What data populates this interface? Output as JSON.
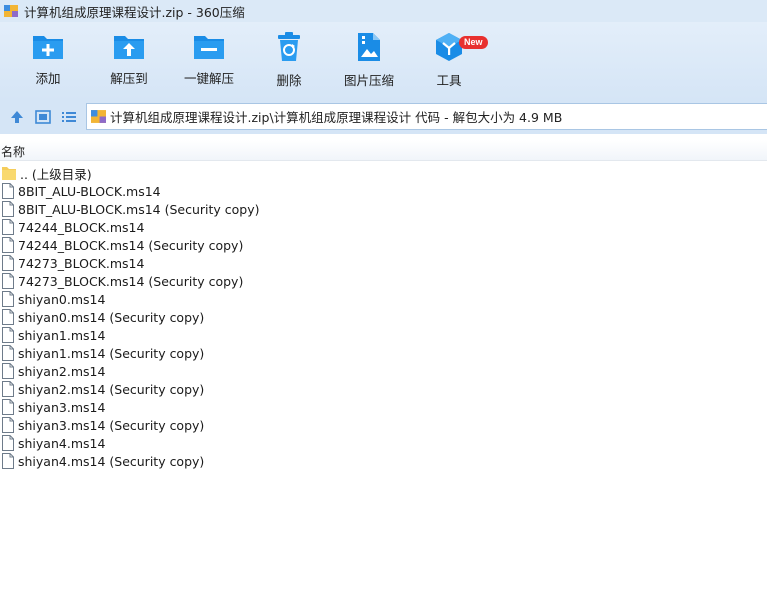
{
  "window": {
    "title": "计算机组成原理课程设计.zip - 360压缩"
  },
  "toolbar": {
    "add_label": "添加",
    "extract_to_label": "解压到",
    "one_click_extract_label": "一键解压",
    "delete_label": "删除",
    "image_compress_label": "图片压缩",
    "tools_label": "工具",
    "tools_badge": "New"
  },
  "address": {
    "path": "计算机组成原理课程设计.zip\\计算机组成原理课程设计 代码 - 解包大小为 4.9 MB"
  },
  "columns": {
    "name": "名称"
  },
  "files": [
    {
      "name": ".. (上级目录)",
      "type": "folder"
    },
    {
      "name": "8BIT_ALU-BLOCK.ms14",
      "type": "file"
    },
    {
      "name": "8BIT_ALU-BLOCK.ms14 (Security copy)",
      "type": "file"
    },
    {
      "name": "74244_BLOCK.ms14",
      "type": "file"
    },
    {
      "name": "74244_BLOCK.ms14 (Security copy)",
      "type": "file"
    },
    {
      "name": "74273_BLOCK.ms14",
      "type": "file"
    },
    {
      "name": "74273_BLOCK.ms14 (Security copy)",
      "type": "file"
    },
    {
      "name": "shiyan0.ms14",
      "type": "file"
    },
    {
      "name": "shiyan0.ms14 (Security copy)",
      "type": "file"
    },
    {
      "name": "shiyan1.ms14",
      "type": "file"
    },
    {
      "name": "shiyan1.ms14 (Security copy)",
      "type": "file"
    },
    {
      "name": "shiyan2.ms14",
      "type": "file"
    },
    {
      "name": "shiyan2.ms14 (Security copy)",
      "type": "file"
    },
    {
      "name": "shiyan3.ms14",
      "type": "file"
    },
    {
      "name": "shiyan3.ms14 (Security copy)",
      "type": "file"
    },
    {
      "name": "shiyan4.ms14",
      "type": "file"
    },
    {
      "name": "shiyan4.ms14 (Security copy)",
      "type": "file"
    }
  ],
  "colors": {
    "accent_blue": "#1a8ce6",
    "folder_yellow": "#f5cd5b",
    "badge_red": "#e8302f",
    "toolbar_bg": "#d5e5f6"
  }
}
